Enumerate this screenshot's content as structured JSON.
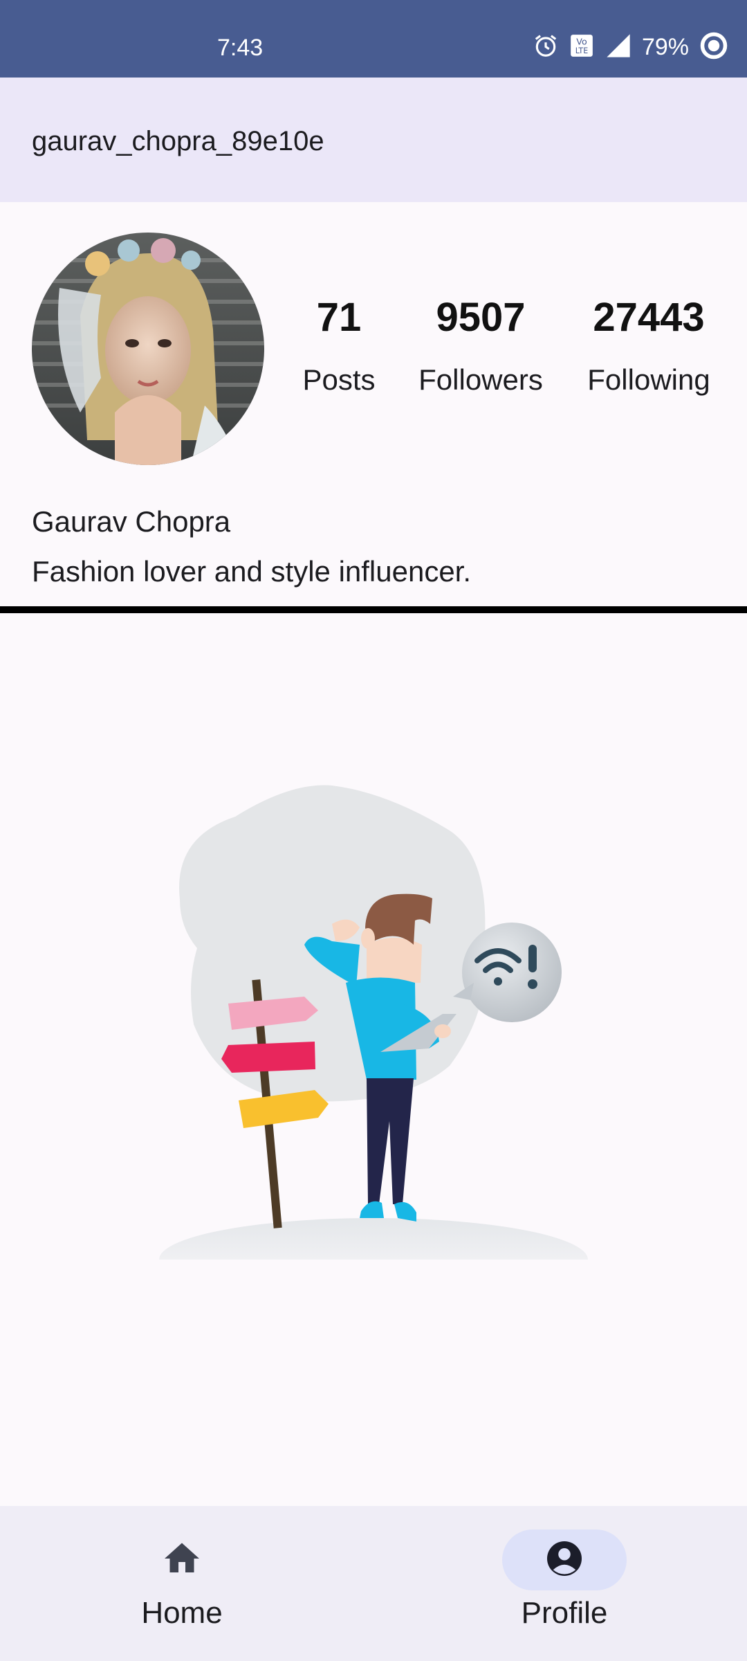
{
  "status_bar": {
    "time": "7:43",
    "battery": "79%",
    "icons": [
      "alarm-icon",
      "volte-icon",
      "signal-icon",
      "battery-ring-icon"
    ],
    "background": "#485c91"
  },
  "app_bar": {
    "title": "gaurav_chopra_89e10e",
    "background": "#ebe7f8"
  },
  "profile": {
    "display_name": "Gaurav Chopra",
    "bio": "Fashion lover and style influencer.",
    "stats": {
      "posts": {
        "value": "71",
        "label": "Posts"
      },
      "followers": {
        "value": "9507",
        "label": "Followers"
      },
      "following": {
        "value": "27443",
        "label": "Following"
      }
    }
  },
  "illustration": {
    "icon": "no-wifi-confused-person-illustration"
  },
  "bottom_nav": {
    "items": [
      {
        "label": "Home",
        "icon": "home-icon",
        "selected": false
      },
      {
        "label": "Profile",
        "icon": "account-circle-icon",
        "selected": true
      }
    ],
    "background": "#efedf6",
    "selected_pill": "#dde1f9"
  }
}
